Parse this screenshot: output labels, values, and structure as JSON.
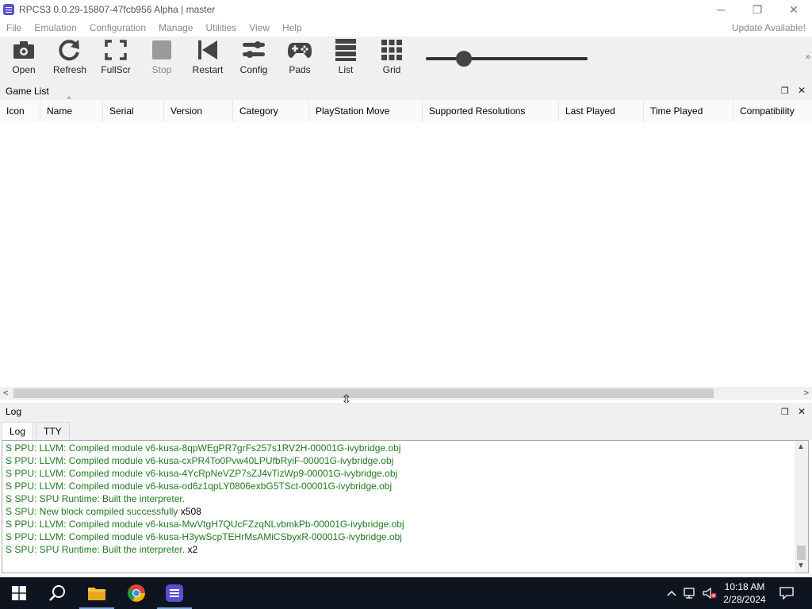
{
  "window": {
    "title": "RPCS3 0.0.29-15807-47fcb956 Alpha | master",
    "minimize_glyph": "─",
    "maximize_glyph": "❐",
    "close_glyph": "✕"
  },
  "menu": {
    "items": [
      "File",
      "Emulation",
      "Configuration",
      "Manage",
      "Utilities",
      "View",
      "Help"
    ],
    "update_label": "Update Available!"
  },
  "toolbar": {
    "buttons": [
      {
        "label": "Open",
        "icon": "camera-icon",
        "enabled": true
      },
      {
        "label": "Refresh",
        "icon": "refresh-icon",
        "enabled": true
      },
      {
        "label": "FullScr",
        "icon": "fullscreen-icon",
        "enabled": true
      },
      {
        "label": "Stop",
        "icon": "stop-icon",
        "enabled": false
      },
      {
        "label": "Restart",
        "icon": "restart-icon",
        "enabled": true
      },
      {
        "label": "Config",
        "icon": "config-icon",
        "enabled": true
      },
      {
        "label": "Pads",
        "icon": "gamepad-icon",
        "enabled": true
      },
      {
        "label": "List",
        "icon": "list-icon",
        "enabled": true
      },
      {
        "label": "Grid",
        "icon": "grid-icon",
        "enabled": true
      }
    ],
    "zoom_level": 0.2,
    "overflow_glyph": "»"
  },
  "game_list": {
    "title": "Game List",
    "columns": [
      "Icon",
      "Name",
      "Serial",
      "Version",
      "Category",
      "PlayStation Move",
      "Supported Resolutions",
      "Last Played",
      "Time Played",
      "Compatibility"
    ],
    "sorted_column": "Name"
  },
  "log_panel": {
    "title": "Log",
    "tabs": [
      "Log",
      "TTY"
    ],
    "active_tab": "Log",
    "lines": [
      {
        "text": "S PPU: LLVM: Compiled module v6-kusa-8qpWEgPR7grFs257s1RV2H-00001G-ivybridge.obj",
        "count": ""
      },
      {
        "text": "S PPU: LLVM: Compiled module v6-kusa-cxPR4To0Pvw40LPUfbRyiF-00001G-ivybridge.obj",
        "count": ""
      },
      {
        "text": "S PPU: LLVM: Compiled module v6-kusa-4YcRpNeVZP7sZJ4vTizWp9-00001G-ivybridge.obj",
        "count": ""
      },
      {
        "text": "S PPU: LLVM: Compiled module v6-kusa-od6z1qpLY0806exbG5TSct-00001G-ivybridge.obj",
        "count": ""
      },
      {
        "text": "S SPU: SPU Runtime: Built the interpreter.",
        "count": ""
      },
      {
        "text": "S SPU: New block compiled successfully",
        "count": "x508"
      },
      {
        "text": "S PPU: LLVM: Compiled module v6-kusa-MwVtgH7QUcFZzqNLvbmkPb-00001G-ivybridge.obj",
        "count": ""
      },
      {
        "text": "S PPU: LLVM: Compiled module v6-kusa-H3ywScpTEHrMsAMiCSbyxR-00001G-ivybridge.obj",
        "count": ""
      },
      {
        "text": "S SPU: SPU Runtime: Built the interpreter.",
        "count": "x2"
      }
    ]
  },
  "taskbar": {
    "time": "10:18 AM",
    "date": "2/28/2024",
    "pinned": [
      "windows-start-icon",
      "search-icon",
      "file-explorer-icon",
      "chrome-icon",
      "rpcs3-icon"
    ]
  },
  "colors": {
    "log_text": "#207a20",
    "accent": "#5a4fd1",
    "taskbar": "#0e1520"
  }
}
